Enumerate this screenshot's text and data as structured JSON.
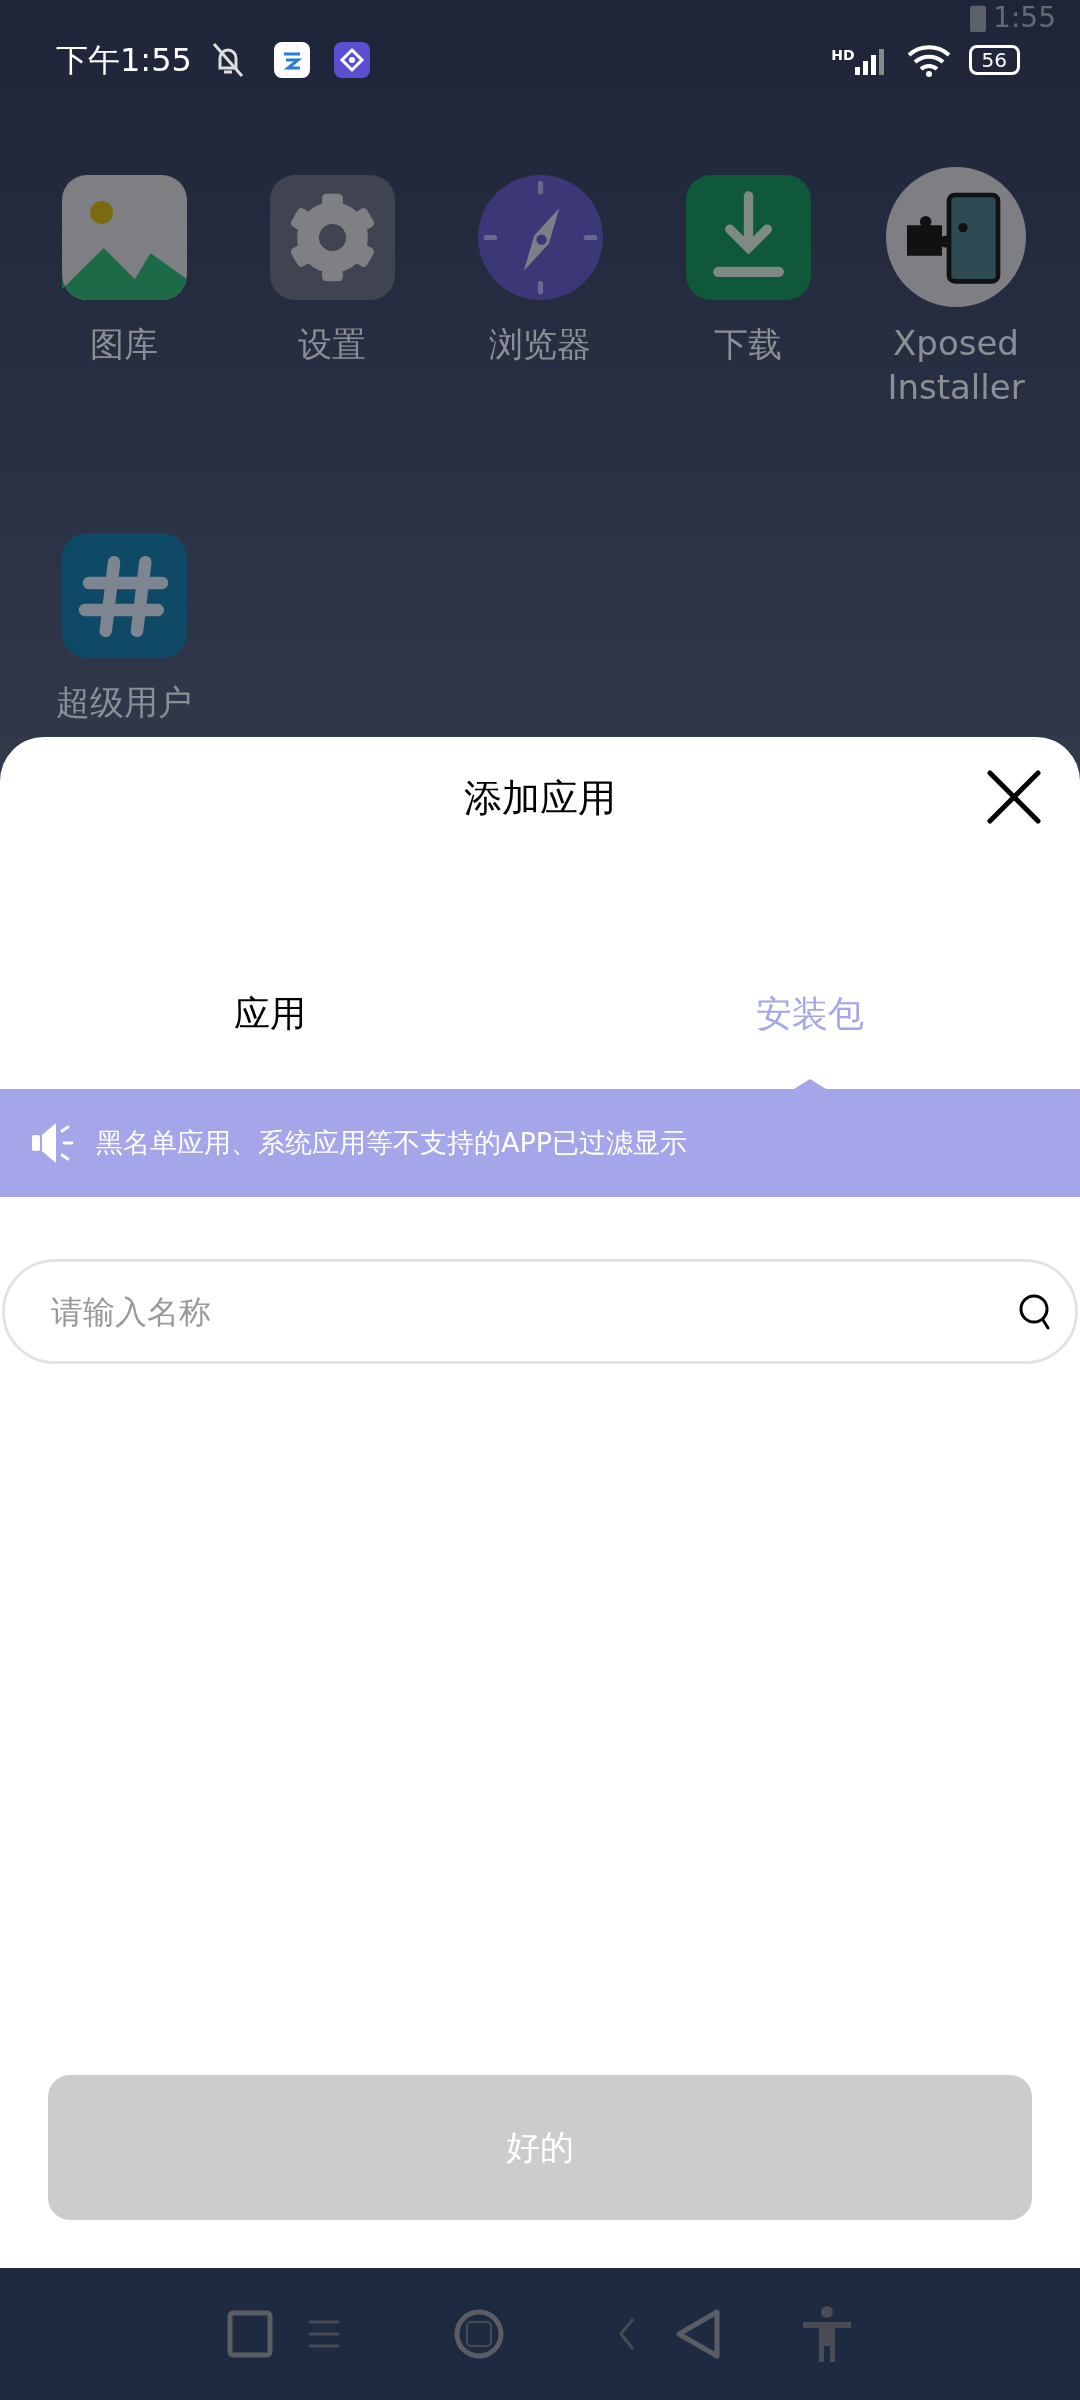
{
  "status_bar": {
    "time": "下午1:55",
    "network": "HD",
    "battery": "56",
    "ghost_time": "1:55"
  },
  "home_apps": [
    {
      "label": "图库",
      "kind": "gallery"
    },
    {
      "label": "设置",
      "kind": "settings"
    },
    {
      "label": "浏览器",
      "kind": "browser"
    },
    {
      "label": "下载",
      "kind": "download"
    },
    {
      "label": "Xposed Installer",
      "kind": "xposed"
    },
    {
      "label": "超级用户",
      "kind": "superuser"
    }
  ],
  "sheet": {
    "title": "添加应用",
    "tabs": [
      {
        "label": "应用",
        "selected": false
      },
      {
        "label": "安装包",
        "selected": true
      }
    ],
    "notice": "黑名单应用、系统应用等不支持的APP已过滤显示",
    "search": {
      "placeholder": "请输入名称"
    },
    "confirm_button": {
      "label": "好的",
      "disabled": true
    }
  }
}
